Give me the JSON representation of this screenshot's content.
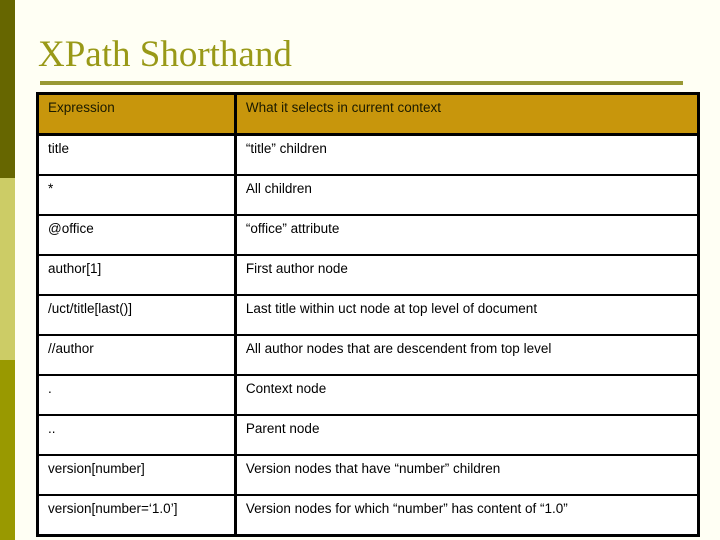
{
  "slide": {
    "title": "XPath Shorthand",
    "background_color": "#FFFFF4",
    "title_color": "#999917",
    "rule_color": "#999933",
    "header_fill": "#C8960C",
    "sidebar": {
      "segments": [
        {
          "name": "top",
          "color": "#666600"
        },
        {
          "name": "middle",
          "color": "#CCCC66"
        },
        {
          "name": "bottom",
          "color": "#999900"
        }
      ]
    }
  },
  "table": {
    "columns": [
      "Expression",
      "What it selects in current context"
    ],
    "rows": [
      {
        "expression": "title",
        "selects": "“title” children"
      },
      {
        "expression": "*",
        "selects": "All children"
      },
      {
        "expression": "@office",
        "selects": "“office” attribute"
      },
      {
        "expression": "author[1]",
        "selects": "First author node"
      },
      {
        "expression": "/uct/title[last()]",
        "selects": "Last title within uct node at top level of document"
      },
      {
        "expression": "//author",
        "selects": "All author nodes that are descendent from top level"
      },
      {
        "expression": ".",
        "selects": "Context node"
      },
      {
        "expression": "..",
        "selects": "Parent node"
      },
      {
        "expression": "version[number]",
        "selects": "Version nodes that have “number” children"
      },
      {
        "expression": "version[number=‘1.0’]",
        "selects": "Version nodes for which “number” has content of “1.0”"
      }
    ]
  }
}
